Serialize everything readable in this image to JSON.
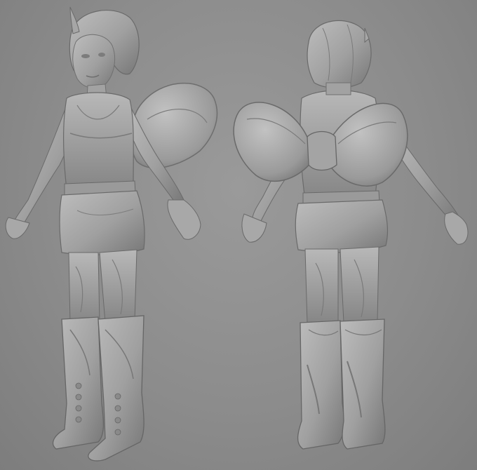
{
  "scene": {
    "background": "#8c8c8c",
    "clay_light": "#b4b4b4",
    "clay_mid": "#9a9a9a",
    "clay_dark": "#6c6c6c",
    "views": [
      {
        "name": "front-three-quarter"
      },
      {
        "name": "back-three-quarter"
      }
    ]
  }
}
